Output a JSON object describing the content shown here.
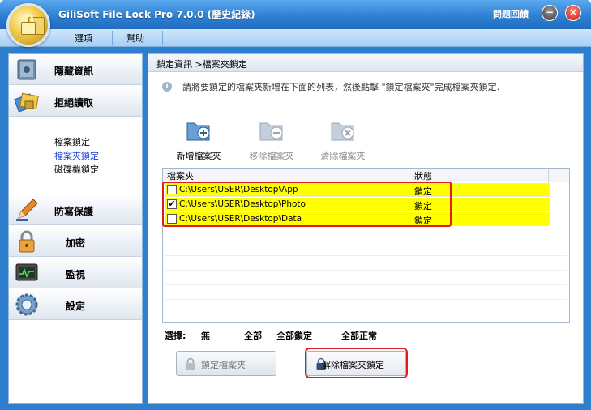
{
  "window": {
    "title": "GiliSoft File Lock Pro 7.0.0 (歷史紀錄)",
    "help": "問題回饋"
  },
  "menu": {
    "options": "選項",
    "help": "幫助"
  },
  "sidebar": {
    "items": [
      {
        "label": "隱藏資訊"
      },
      {
        "label": "拒絕讀取"
      },
      {
        "label": "防寫保護"
      },
      {
        "label": "加密"
      },
      {
        "label": "監視"
      },
      {
        "label": "設定"
      }
    ],
    "submenu": [
      {
        "label": "檔案鎖定"
      },
      {
        "label": "檔案夾鎖定"
      },
      {
        "label": "磁碟機鎖定"
      }
    ]
  },
  "main": {
    "breadcrumb": "鎖定資訊 >檔案夾鎖定",
    "instruction": "請將要鎖定的檔案夾新增在下面的列表，然後點擊 \"鎖定檔案夾\"完成檔案夾鎖定.",
    "toolbar": {
      "add": "新增檔案夾",
      "remove": "移除檔案夾",
      "clear": "清除檔案夾"
    },
    "table": {
      "columns": [
        "檔案夾",
        "狀態"
      ],
      "rows": [
        {
          "path": "C:\\Users\\USER\\Desktop\\App",
          "status": "鎖定",
          "checked": false
        },
        {
          "path": "C:\\Users\\USER\\Desktop\\Photo",
          "status": "鎖定",
          "checked": true
        },
        {
          "path": "C:\\Users\\USER\\Desktop\\Data",
          "status": "鎖定",
          "checked": false
        }
      ]
    },
    "select": {
      "label": "選擇:",
      "none": "無",
      "all": "全部",
      "all_locked": "全部鎖定",
      "all_normal": "全部正常"
    },
    "buttons": {
      "lock": "鎖定檔案夾",
      "unlock": "解除檔案夾鎖定"
    }
  },
  "colors": {
    "titlebar": "#2f80d2",
    "locked_row": "#ffff00",
    "highlight": "#e21b1b"
  }
}
